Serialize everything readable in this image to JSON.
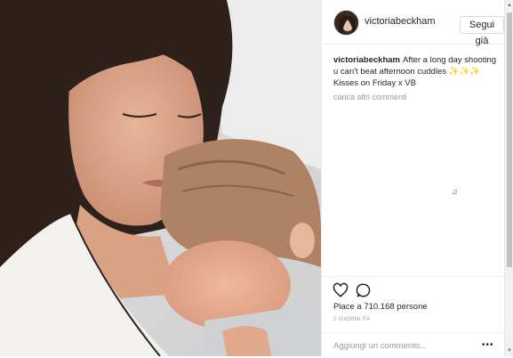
{
  "post": {
    "username": "victoriabeckham",
    "follow_label": "Segui già",
    "caption_author": "victoriabeckham",
    "caption_text": "After a long day shooting u can't beat afternoon cuddles ✨✨✨ Kisses on Friday x VB",
    "load_more": "carica altri commenti",
    "music_note": "♫",
    "likes": "Piace a 710.168 persone",
    "timestamp": "2 giorni fa",
    "comment_placeholder": "Aggiungi un commento...",
    "more_label": "•••"
  },
  "icons": {
    "like": "heart-icon",
    "comment": "speech-bubble-icon"
  },
  "colors": {
    "text": "#262626",
    "muted": "#999999",
    "border": "#efefef"
  }
}
